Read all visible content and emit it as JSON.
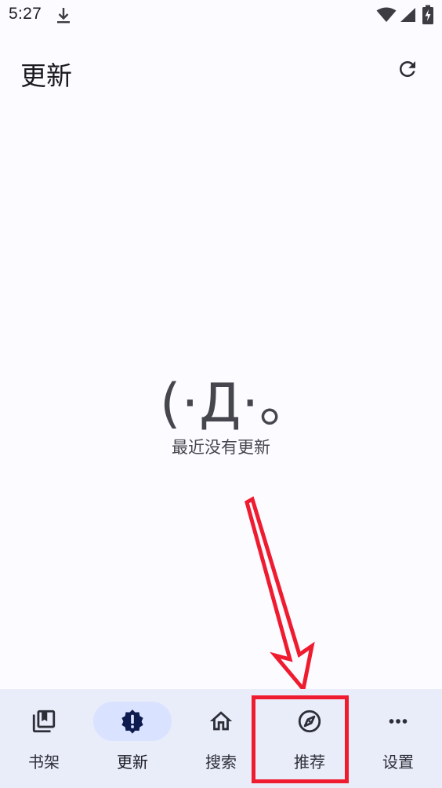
{
  "status_bar": {
    "time": "5:27",
    "icons": [
      "download-icon",
      "wifi-icon",
      "signal-icon",
      "battery-icon"
    ]
  },
  "top_bar": {
    "title": "更新",
    "action_icon": "refresh-icon"
  },
  "empty_state": {
    "face": "(·Д·。",
    "message": "最近没有更新"
  },
  "bottom_nav": {
    "items": [
      {
        "label": "书架",
        "icon": "bookshelf-icon",
        "active": false
      },
      {
        "label": "更新",
        "icon": "updates-alert-icon",
        "active": true
      },
      {
        "label": "搜索",
        "icon": "home-icon",
        "active": false
      },
      {
        "label": "推荐",
        "icon": "compass-icon",
        "active": false
      },
      {
        "label": "设置",
        "icon": "more-horizontal-icon",
        "active": false
      }
    ]
  },
  "annotation": {
    "highlighted_item": "推荐",
    "color": "#ef1c30"
  },
  "colors": {
    "background": "#fcfbff",
    "nav_background": "#e9ecf9",
    "active_indicator": "#d9e2ff",
    "active_icon": "#0d1b4f"
  }
}
